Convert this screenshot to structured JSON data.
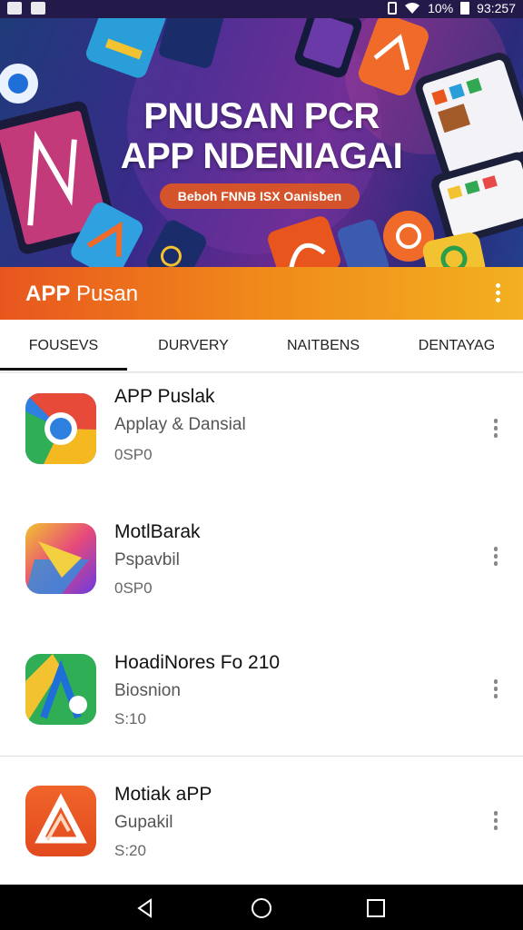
{
  "status_bar": {
    "battery_text": "10%",
    "time": "93:257"
  },
  "banner": {
    "title_line1": "PNUSAN PCR",
    "title_line2": "APP NDENIAGAI",
    "pill_text": "Beboh FNNB ISX Oanisben"
  },
  "app_bar": {
    "title_bold": "APP",
    "title_rest": "Pusan"
  },
  "tabs": [
    "FOUSEVS",
    "DURVERY",
    "NAITBENS",
    "DENTAYAG"
  ],
  "apps": [
    {
      "name": "APP Puslak",
      "subtitle": "Applay & Dansial",
      "meta": "0SP0",
      "icon": "chrome-icon"
    },
    {
      "name": "MotlBarak",
      "subtitle": "Pspavbil",
      "meta": "0SP0",
      "icon": "arrow-gradient-icon"
    },
    {
      "name": "HoadiNores Fo 210",
      "subtitle": "Biosnion",
      "meta": "S:10",
      "icon": "drive-arc-icon"
    },
    {
      "name": "Motiak aPP",
      "subtitle": "Gupakil",
      "meta": "S:20",
      "icon": "triangle-logo-icon"
    }
  ],
  "colors": {
    "app_bar_start": "#e8561e",
    "app_bar_end": "#f3b020",
    "status_bar": "#241a4a"
  }
}
